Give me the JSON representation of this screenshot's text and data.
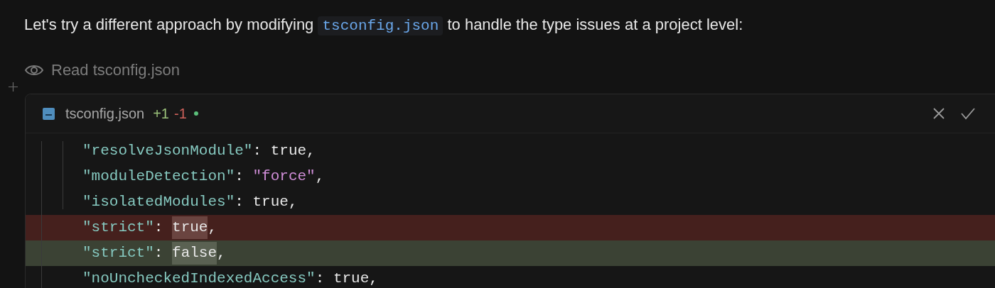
{
  "message": {
    "before": "Let's try a different approach by modifying",
    "code": "tsconfig.json",
    "after": "to handle the type issues at a project level:"
  },
  "read_step": {
    "label": "Read tsconfig.json"
  },
  "diff_card": {
    "filename": "tsconfig.json",
    "added": "+1",
    "removed": "-1",
    "lines": [
      {
        "key": "\"resolveJsonModule\"",
        "sep": ":",
        "value": "true",
        "kind": "keyword",
        "end": ",",
        "removed": false,
        "added": false
      },
      {
        "key": "\"moduleDetection\"",
        "sep": ":",
        "value": "\"force\"",
        "kind": "string",
        "end": ",",
        "removed": false,
        "added": false
      },
      {
        "key": "\"isolatedModules\"",
        "sep": ":",
        "value": "true",
        "kind": "keyword",
        "end": ",",
        "removed": false,
        "added": false
      },
      {
        "key": "\"strict\"",
        "sep": ":",
        "value": "true",
        "kind": "keyword",
        "end": ",",
        "removed": true,
        "added": false
      },
      {
        "key": "\"strict\"",
        "sep": ":",
        "value": "false",
        "kind": "keyword",
        "end": ",",
        "removed": false,
        "added": true
      },
      {
        "key": "\"noUncheckedIndexedAccess\"",
        "sep": ":",
        "value": "true",
        "kind": "keyword",
        "end": ",",
        "removed": false,
        "added": false
      }
    ]
  }
}
